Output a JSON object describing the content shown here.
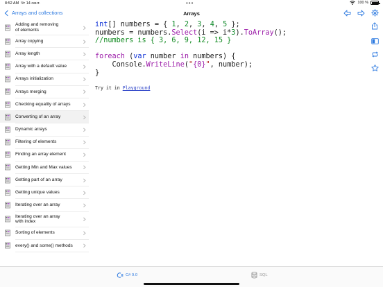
{
  "statusbar": {
    "time": "8:52 AM",
    "date": "Чт 14 сент.",
    "battery": "100 %"
  },
  "navbar": {
    "back_label": "Arrays and collections",
    "title": "Arrays",
    "icons": [
      "arrow-left-icon",
      "arrow-right-icon",
      "gear-icon"
    ]
  },
  "sidebar": {
    "selected_index": 8,
    "items": [
      {
        "label_line1": "Adding and removing",
        "label_line2": "of elements"
      },
      {
        "label_line1": "Array copying",
        "label_line2": ""
      },
      {
        "label_line1": "Array length",
        "label_line2": ""
      },
      {
        "label_line1": "Array with a default value",
        "label_line2": ""
      },
      {
        "label_line1": "Arrays initialization",
        "label_line2": ""
      },
      {
        "label_line1": "Arrays merging",
        "label_line2": ""
      },
      {
        "label_line1": "Checking equality of arrays",
        "label_line2": ""
      },
      {
        "label_line1": "Converting of an array",
        "label_line2": ""
      },
      {
        "label_line1": "Dynamic arrays",
        "label_line2": ""
      },
      {
        "label_line1": "Filtering of elements",
        "label_line2": ""
      },
      {
        "label_line1": "Finding an array element",
        "label_line2": ""
      },
      {
        "label_line1": "Getting Min and Max values",
        "label_line2": ""
      },
      {
        "label_line1": "Getting part of an array",
        "label_line2": ""
      },
      {
        "label_line1": "Getting unique values",
        "label_line2": ""
      },
      {
        "label_line1": "Iterating over an array",
        "label_line2": ""
      },
      {
        "label_line1": "Iterating over an array",
        "label_line2": "with index"
      },
      {
        "label_line1": "Sorting of elements",
        "label_line2": ""
      },
      {
        "label_line1": "every() and some() methods",
        "label_line2": ""
      }
    ]
  },
  "code": {
    "l1": {
      "kw": "int",
      "a": "[] numbers = { ",
      "n1": "1",
      "c1": ", ",
      "n2": "2",
      "c2": ", ",
      "n3": "3",
      "c3": ", ",
      "n4": "4",
      "c4": ", ",
      "n5": "5",
      "end": " };"
    },
    "l2": {
      "a": "numbers = numbers.",
      "m1": "Select",
      "b": "(i => i*",
      "n": "3",
      "c": ").",
      "m2": "ToArray",
      "d": "();"
    },
    "l3": "//numbers is { 3, 6, 9, 12, 15 }",
    "l5": {
      "kw1": "foreach",
      "a": " (",
      "kw2": "var",
      "b": " number ",
      "kw3": "in",
      "c": " numbers) {"
    },
    "l6": {
      "indent": "    ",
      "a": "Console.",
      "m": "WriteLine",
      "b": "(",
      "s1": "\"",
      "s2": "{0}",
      "s3": "\"",
      "c": ", number);"
    },
    "l7": "}"
  },
  "tryit": {
    "prefix": "Try it in ",
    "link": "Playground"
  },
  "rail_icons": [
    "share-icon",
    "book-icon",
    "loop-icon",
    "star-icon"
  ],
  "tabbar": {
    "tabs": [
      {
        "label": "C# 9.0",
        "icon": "csharp-icon",
        "active": true
      },
      {
        "label": "SQL",
        "icon": "database-icon",
        "active": false
      }
    ]
  },
  "colors": {
    "accent": "#2f7be0",
    "keyword": "#0b2fd6",
    "method": "#9b1ba8",
    "number": "#128a2b",
    "comment": "#118a20",
    "string": "#b3261e"
  }
}
